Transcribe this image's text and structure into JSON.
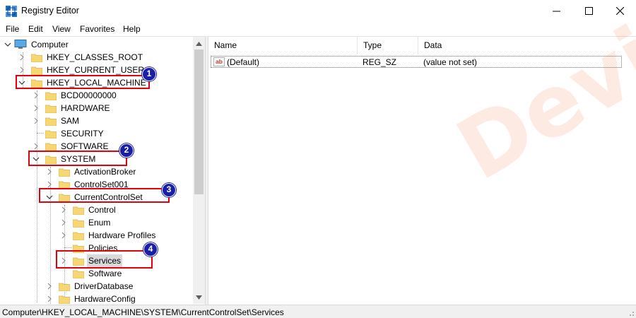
{
  "window": {
    "title": "Registry Editor",
    "icon": "registry-icon",
    "controls": [
      "minimize-icon",
      "maximize-icon",
      "close-icon"
    ]
  },
  "menu": {
    "items": [
      "File",
      "Edit",
      "View",
      "Favorites",
      "Help"
    ]
  },
  "tree": {
    "root": "Computer",
    "nodes": [
      {
        "label": "HKEY_CLASSES_ROOT",
        "expanded": false
      },
      {
        "label": "HKEY_CURRENT_USER",
        "expanded": false
      },
      {
        "label": "HKEY_LOCAL_MACHINE",
        "expanded": true
      },
      {
        "label": "BCD00000000",
        "expanded": false
      },
      {
        "label": "HARDWARE",
        "expanded": false
      },
      {
        "label": "SAM",
        "expanded": false
      },
      {
        "label": "SECURITY",
        "expanded": false
      },
      {
        "label": "SOFTWARE",
        "expanded": false
      },
      {
        "label": "SYSTEM",
        "expanded": true
      },
      {
        "label": "ActivationBroker",
        "expanded": false
      },
      {
        "label": "ControlSet001",
        "expanded": false
      },
      {
        "label": "CurrentControlSet",
        "expanded": true
      },
      {
        "label": "Control",
        "expanded": false
      },
      {
        "label": "Enum",
        "expanded": false
      },
      {
        "label": "Hardware Profiles",
        "expanded": false
      },
      {
        "label": "Policies",
        "expanded": false
      },
      {
        "label": "Services",
        "expanded": false,
        "selected": true
      },
      {
        "label": "Software",
        "expanded": false
      },
      {
        "label": "DriverDatabase",
        "expanded": false
      },
      {
        "label": "HardwareConfig",
        "expanded": false
      }
    ]
  },
  "list": {
    "columns": [
      "Name",
      "Type",
      "Data"
    ],
    "rows": [
      {
        "icon": "ab",
        "name": "(Default)",
        "type": "REG_SZ",
        "data": "(value not set)"
      }
    ]
  },
  "status": {
    "path": "Computer\\HKEY_LOCAL_MACHINE\\SYSTEM\\CurrentControlSet\\Services"
  },
  "annotations": {
    "steps": [
      "1",
      "2",
      "3",
      "4"
    ],
    "color": "#e3000f",
    "badge_color": "#1a1fa8"
  },
  "watermark": {
    "text": "DeviceTricks"
  }
}
